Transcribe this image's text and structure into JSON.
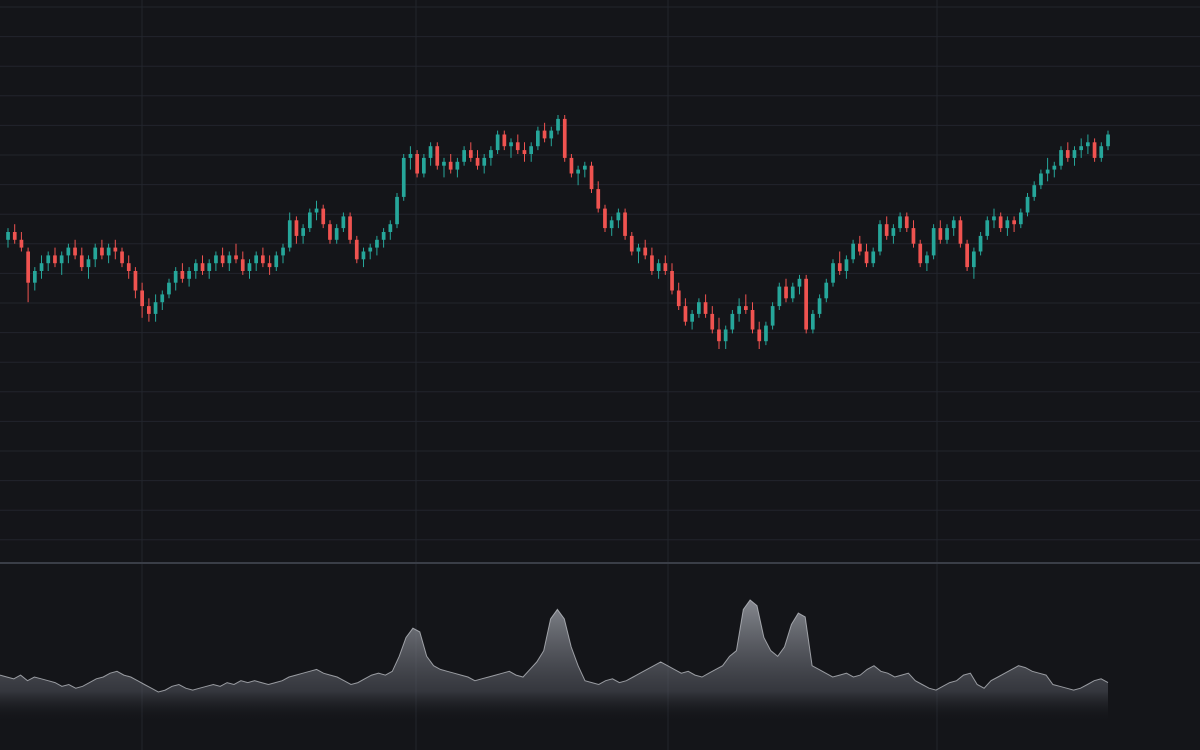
{
  "colors": {
    "background": "#141519",
    "grid": "#22252c",
    "separator": "#3a3e47",
    "up": "#26a69a",
    "down": "#ef5350",
    "volume_fill": "#8a8d94",
    "volume_line": "#c9ccd2"
  },
  "chart_data": {
    "type": "candlestick",
    "title": "",
    "xlabel": "",
    "ylabel": "",
    "grid": true,
    "legend": "none",
    "ylim": [
      0,
      100
    ],
    "candles": [
      [
        68,
        71,
        66,
        70
      ],
      [
        70,
        72,
        67,
        68
      ],
      [
        68,
        70,
        65,
        66
      ],
      [
        65,
        66,
        52,
        57
      ],
      [
        57,
        61,
        55,
        60
      ],
      [
        60,
        64,
        58,
        62
      ],
      [
        62,
        65,
        60,
        64
      ],
      [
        64,
        66,
        61,
        62
      ],
      [
        62,
        65,
        59,
        64
      ],
      [
        64,
        67,
        62,
        66
      ],
      [
        66,
        68,
        63,
        64
      ],
      [
        64,
        66,
        60,
        61
      ],
      [
        61,
        64,
        58,
        63
      ],
      [
        63,
        67,
        61,
        66
      ],
      [
        66,
        68,
        63,
        64
      ],
      [
        64,
        67,
        62,
        66
      ],
      [
        66,
        68,
        63,
        65
      ],
      [
        65,
        66,
        61,
        62
      ],
      [
        62,
        64,
        58,
        60
      ],
      [
        60,
        61,
        53,
        55
      ],
      [
        55,
        57,
        48,
        51
      ],
      [
        51,
        53,
        47,
        49
      ],
      [
        49,
        54,
        47,
        52
      ],
      [
        52,
        55,
        50,
        54
      ],
      [
        54,
        58,
        53,
        57
      ],
      [
        57,
        61,
        55,
        60
      ],
      [
        60,
        62,
        57,
        58
      ],
      [
        58,
        61,
        56,
        60
      ],
      [
        60,
        63,
        58,
        62
      ],
      [
        62,
        64,
        59,
        60
      ],
      [
        60,
        63,
        58,
        62
      ],
      [
        62,
        65,
        60,
        64
      ],
      [
        64,
        66,
        61,
        62
      ],
      [
        62,
        65,
        60,
        64
      ],
      [
        64,
        67,
        62,
        63
      ],
      [
        63,
        65,
        59,
        60
      ],
      [
        60,
        63,
        58,
        62
      ],
      [
        62,
        65,
        60,
        64
      ],
      [
        64,
        66,
        61,
        62
      ],
      [
        62,
        64,
        59,
        61
      ],
      [
        61,
        65,
        60,
        64
      ],
      [
        64,
        67,
        62,
        66
      ],
      [
        66,
        75,
        65,
        73
      ],
      [
        73,
        74,
        67,
        69
      ],
      [
        69,
        72,
        67,
        71
      ],
      [
        71,
        76,
        70,
        75
      ],
      [
        75,
        78,
        73,
        76
      ],
      [
        76,
        77,
        71,
        72
      ],
      [
        72,
        73,
        67,
        68
      ],
      [
        68,
        72,
        67,
        71
      ],
      [
        71,
        75,
        70,
        74
      ],
      [
        74,
        75,
        67,
        68
      ],
      [
        68,
        69,
        62,
        63
      ],
      [
        63,
        66,
        61,
        65
      ],
      [
        65,
        67,
        63,
        66
      ],
      [
        66,
        69,
        64,
        68
      ],
      [
        68,
        71,
        66,
        70
      ],
      [
        70,
        73,
        68,
        72
      ],
      [
        72,
        80,
        71,
        79
      ],
      [
        79,
        90,
        78,
        89
      ],
      [
        89,
        92,
        86,
        90
      ],
      [
        90,
        91,
        84,
        85
      ],
      [
        85,
        90,
        84,
        89
      ],
      [
        89,
        93,
        87,
        92
      ],
      [
        92,
        93,
        86,
        87
      ],
      [
        87,
        89,
        84,
        88
      ],
      [
        88,
        90,
        85,
        86
      ],
      [
        86,
        89,
        84,
        88
      ],
      [
        88,
        92,
        87,
        91
      ],
      [
        91,
        93,
        88,
        89
      ],
      [
        89,
        91,
        86,
        87
      ],
      [
        87,
        90,
        85,
        89
      ],
      [
        89,
        92,
        87,
        91
      ],
      [
        91,
        96,
        90,
        95
      ],
      [
        95,
        96,
        91,
        92
      ],
      [
        92,
        94,
        89,
        93
      ],
      [
        93,
        95,
        90,
        91
      ],
      [
        91,
        93,
        88,
        90
      ],
      [
        90,
        93,
        88,
        92
      ],
      [
        92,
        97,
        91,
        96
      ],
      [
        96,
        98,
        93,
        94
      ],
      [
        94,
        97,
        92,
        96
      ],
      [
        96,
        100,
        95,
        99
      ],
      [
        99,
        100,
        88,
        89
      ],
      [
        89,
        90,
        84,
        85
      ],
      [
        85,
        87,
        82,
        86
      ],
      [
        86,
        88,
        84,
        87
      ],
      [
        87,
        88,
        80,
        81
      ],
      [
        81,
        83,
        75,
        76
      ],
      [
        76,
        77,
        70,
        71
      ],
      [
        71,
        74,
        69,
        73
      ],
      [
        73,
        76,
        71,
        75
      ],
      [
        75,
        76,
        68,
        69
      ],
      [
        69,
        70,
        64,
        65
      ],
      [
        65,
        67,
        62,
        66
      ],
      [
        66,
        68,
        63,
        64
      ],
      [
        64,
        66,
        59,
        60
      ],
      [
        60,
        63,
        58,
        62
      ],
      [
        62,
        64,
        59,
        60
      ],
      [
        60,
        62,
        54,
        55
      ],
      [
        55,
        57,
        50,
        51
      ],
      [
        51,
        53,
        46,
        47
      ],
      [
        47,
        50,
        45,
        49
      ],
      [
        49,
        53,
        48,
        52
      ],
      [
        52,
        54,
        48,
        49
      ],
      [
        49,
        51,
        44,
        45
      ],
      [
        45,
        48,
        40,
        42
      ],
      [
        42,
        46,
        40,
        45
      ],
      [
        45,
        50,
        44,
        49
      ],
      [
        49,
        53,
        47,
        51
      ],
      [
        51,
        54,
        49,
        50
      ],
      [
        50,
        52,
        44,
        45
      ],
      [
        45,
        47,
        40,
        42
      ],
      [
        42,
        47,
        41,
        46
      ],
      [
        46,
        52,
        45,
        51
      ],
      [
        51,
        57,
        50,
        56
      ],
      [
        56,
        58,
        52,
        53
      ],
      [
        53,
        57,
        52,
        56
      ],
      [
        56,
        59,
        54,
        58
      ],
      [
        58,
        59,
        44,
        45
      ],
      [
        45,
        50,
        44,
        49
      ],
      [
        49,
        54,
        48,
        53
      ],
      [
        53,
        58,
        52,
        57
      ],
      [
        57,
        63,
        56,
        62
      ],
      [
        62,
        65,
        59,
        60
      ],
      [
        60,
        64,
        58,
        63
      ],
      [
        63,
        68,
        62,
        67
      ],
      [
        67,
        69,
        64,
        65
      ],
      [
        65,
        67,
        61,
        62
      ],
      [
        62,
        66,
        61,
        65
      ],
      [
        65,
        73,
        64,
        72
      ],
      [
        72,
        74,
        68,
        69
      ],
      [
        69,
        72,
        67,
        71
      ],
      [
        71,
        75,
        70,
        74
      ],
      [
        74,
        75,
        70,
        71
      ],
      [
        71,
        73,
        66,
        67
      ],
      [
        67,
        68,
        61,
        62
      ],
      [
        62,
        65,
        60,
        64
      ],
      [
        64,
        72,
        63,
        71
      ],
      [
        71,
        73,
        67,
        68
      ],
      [
        68,
        72,
        67,
        71
      ],
      [
        71,
        74,
        69,
        73
      ],
      [
        73,
        74,
        66,
        67
      ],
      [
        67,
        68,
        60,
        61
      ],
      [
        61,
        66,
        58,
        65
      ],
      [
        65,
        70,
        64,
        69
      ],
      [
        69,
        74,
        68,
        73
      ],
      [
        73,
        76,
        71,
        74
      ],
      [
        74,
        75,
        70,
        71
      ],
      [
        71,
        74,
        69,
        73
      ],
      [
        73,
        74,
        70,
        72
      ],
      [
        72,
        76,
        71,
        75
      ],
      [
        75,
        80,
        74,
        79
      ],
      [
        79,
        83,
        78,
        82
      ],
      [
        82,
        86,
        81,
        85
      ],
      [
        85,
        89,
        83,
        86
      ],
      [
        86,
        88,
        84,
        87
      ],
      [
        87,
        92,
        86,
        91
      ],
      [
        91,
        93,
        88,
        89
      ],
      [
        89,
        92,
        87,
        91
      ],
      [
        91,
        94,
        89,
        92
      ],
      [
        92,
        95,
        90,
        93
      ],
      [
        93,
        94,
        88,
        89
      ],
      [
        89,
        93,
        88,
        92
      ],
      [
        92,
        96,
        91,
        95
      ]
    ],
    "volume": [
      25,
      24,
      23,
      25,
      22,
      24,
      23,
      22,
      21,
      19,
      20,
      18,
      19,
      21,
      23,
      24,
      26,
      27,
      25,
      24,
      22,
      20,
      18,
      16,
      17,
      19,
      20,
      18,
      17,
      18,
      19,
      20,
      19,
      21,
      20,
      22,
      21,
      22,
      21,
      20,
      21,
      22,
      24,
      25,
      26,
      27,
      28,
      26,
      25,
      24,
      22,
      20,
      21,
      23,
      25,
      26,
      25,
      27,
      35,
      45,
      50,
      48,
      35,
      30,
      28,
      27,
      26,
      25,
      24,
      22,
      23,
      24,
      25,
      26,
      27,
      25,
      24,
      28,
      32,
      38,
      55,
      60,
      55,
      40,
      30,
      22,
      21,
      20,
      22,
      23,
      21,
      22,
      24,
      26,
      28,
      30,
      32,
      30,
      28,
      26,
      27,
      25,
      24,
      26,
      28,
      30,
      35,
      38,
      60,
      65,
      62,
      45,
      38,
      35,
      40,
      52,
      58,
      56,
      30,
      28,
      26,
      24,
      25,
      26,
      24,
      25,
      28,
      30,
      27,
      26,
      24,
      25,
      26,
      22,
      20,
      18,
      17,
      19,
      21,
      22,
      25,
      26,
      20,
      18,
      22,
      24,
      26,
      28,
      30,
      29,
      27,
      26,
      25,
      20,
      19,
      18,
      17,
      18,
      20,
      22,
      23,
      21
    ]
  }
}
